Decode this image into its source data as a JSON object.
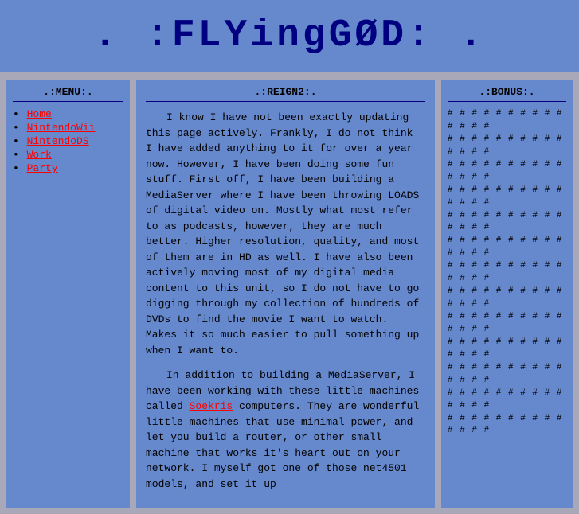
{
  "header": {
    "title": ". :FLYingGØD: ."
  },
  "sidebar": {
    "title": ".:MENU:.",
    "items": [
      {
        "label": "Home",
        "href": "#"
      },
      {
        "label": "NintendoWii",
        "href": "#"
      },
      {
        "label": "NintendoDS",
        "href": "#"
      },
      {
        "label": "Work",
        "href": "#"
      },
      {
        "label": "Party",
        "href": "#"
      }
    ]
  },
  "content": {
    "title": ".:REIGN2:.",
    "paragraphs": [
      "I know I have not been exactly updating this page actively. Frankly, I do not think I have added anything to it for over a year now. However, I have been doing some fun stuff. First off, I have been building a MediaServer where I have been throwing LOADS of digital video on. Mostly what most refer to as podcasts, however, they are much better. Higher resolution, quality, and most of them are in HD as well. I have also been actively moving most of my digital media content to this unit, so I do not have to go digging through my collection of hundreds of DVDs to find the movie I want to watch. Makes it so much easier to pull something up when I want to.",
      "In addition to building a MediaServer, I have been working with these little machines called Soekris computers. They are wonderful little machines that use minimal power, and let you build a router, or other small machine that works it's heart out on your network. I myself got one of those net4501 models, and set it up"
    ],
    "soekris_link": "Soekris"
  },
  "bonus": {
    "title": ".:BONUS:.",
    "hash_rows": 13,
    "hash_cols": 14
  }
}
